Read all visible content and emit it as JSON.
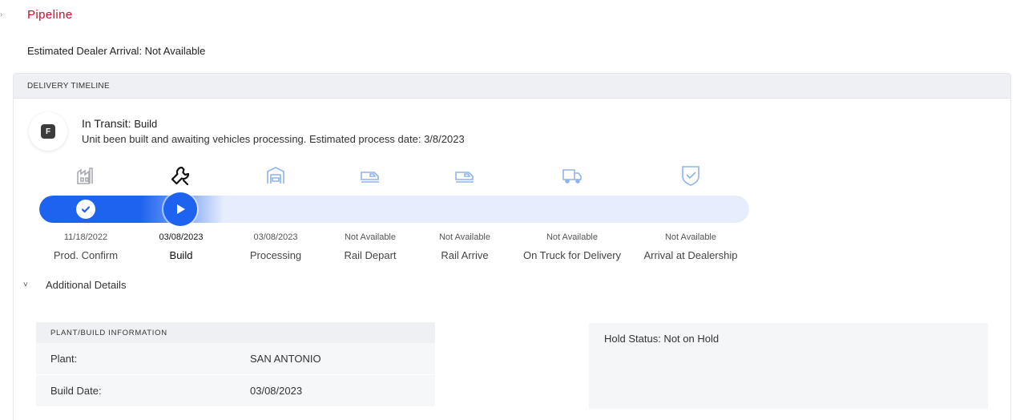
{
  "page": {
    "title": "Pipeline",
    "eta": "Estimated Dealer Arrival: Not Available"
  },
  "timeline": {
    "header": "DELIVERY TIMELINE",
    "status": {
      "badge": "F",
      "label": "In Transit:",
      "stage": "Build",
      "description": "Unit been built and awaiting vehicles processing. Estimated process date: 3/8/2023"
    },
    "progress_steps_completed": 1,
    "current_step_index": 1,
    "steps": [
      {
        "date": "11/18/2022",
        "label": "Prod. Confirm",
        "icon": "factory-icon",
        "state": "done"
      },
      {
        "date": "03/08/2023",
        "label": "Build",
        "icon": "wrench-icon",
        "state": "current"
      },
      {
        "date": "03/08/2023",
        "label": "Processing",
        "icon": "processing-garage-icon",
        "state": "pending"
      },
      {
        "date": "Not Available",
        "label": "Rail Depart",
        "icon": "rail-depart-icon",
        "state": "pending"
      },
      {
        "date": "Not Available",
        "label": "Rail Arrive",
        "icon": "rail-arrive-icon",
        "state": "pending"
      },
      {
        "date": "Not Available",
        "label": "On Truck for Delivery",
        "icon": "truck-icon",
        "state": "pending"
      },
      {
        "date": "Not Available",
        "label": "Arrival at Dealership",
        "icon": "shield-check-icon",
        "state": "pending"
      }
    ]
  },
  "details": {
    "toggle_label": "Additional Details",
    "plant": {
      "header": "PLANT/BUILD INFORMATION",
      "rows": [
        {
          "key": "Plant:",
          "value": "SAN ANTONIO"
        },
        {
          "key": "Build Date:",
          "value": "03/08/2023"
        }
      ]
    },
    "hold_status": "Hold Status: Not on Hold"
  },
  "colors": {
    "brand_red": "#c8102e",
    "progress_blue": "#1e63f0",
    "track_light": "#e6edfc",
    "pending_icon": "#8fb3ec"
  }
}
